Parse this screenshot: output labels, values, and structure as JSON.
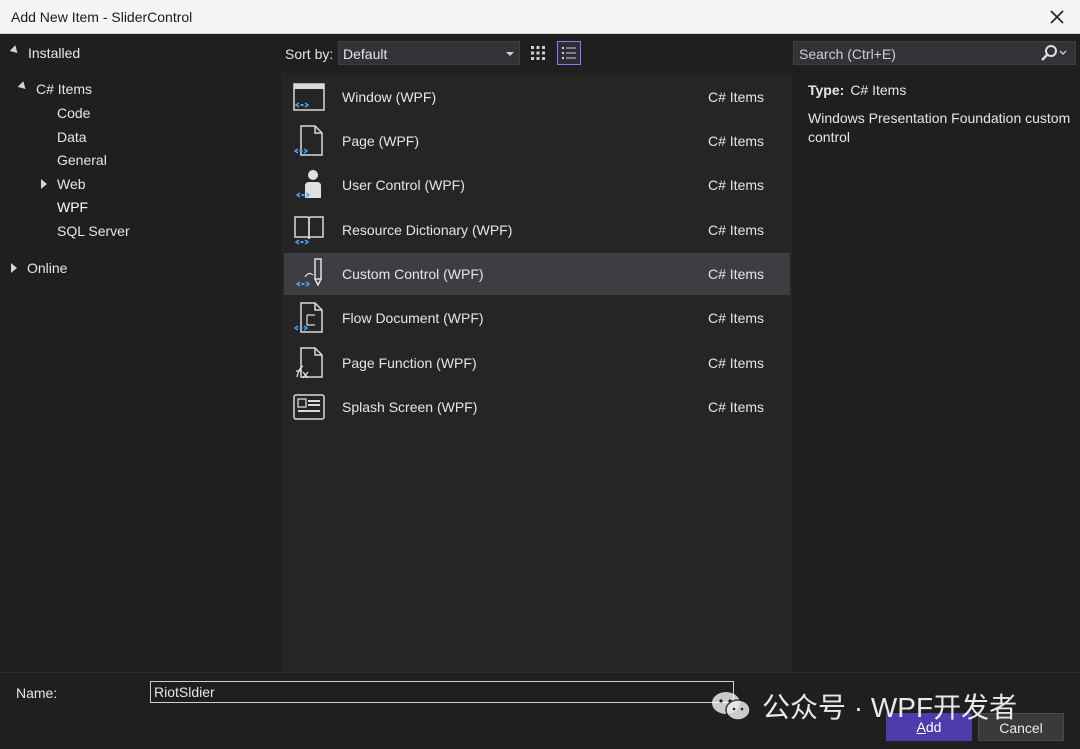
{
  "window": {
    "title": "Add New Item - SliderControl"
  },
  "tree": {
    "installed": "Installed",
    "csharp_items": "C# Items",
    "children": [
      "Code",
      "Data",
      "General",
      "Web",
      "WPF",
      "SQL Server"
    ],
    "online": "Online"
  },
  "toolbar": {
    "sort_label": "Sort by:",
    "sort_value": "Default"
  },
  "items": [
    {
      "name": "Window (WPF)",
      "category": "C# Items",
      "icon": "window-wpf-icon"
    },
    {
      "name": "Page (WPF)",
      "category": "C# Items",
      "icon": "page-wpf-icon"
    },
    {
      "name": "User Control (WPF)",
      "category": "C# Items",
      "icon": "user-control-icon"
    },
    {
      "name": "Resource Dictionary (WPF)",
      "category": "C# Items",
      "icon": "resource-dictionary-icon"
    },
    {
      "name": "Custom Control (WPF)",
      "category": "C# Items",
      "icon": "custom-control-icon",
      "selected": true
    },
    {
      "name": "Flow Document (WPF)",
      "category": "C# Items",
      "icon": "flow-document-icon"
    },
    {
      "name": "Page Function (WPF)",
      "category": "C# Items",
      "icon": "page-function-icon"
    },
    {
      "name": "Splash Screen (WPF)",
      "category": "C# Items",
      "icon": "splash-screen-icon"
    }
  ],
  "search": {
    "placeholder": "Search (Ctrl+E)"
  },
  "details": {
    "type_label": "Type:",
    "type_value": "C# Items",
    "description": "Windows Presentation Foundation custom control"
  },
  "footer": {
    "name_label": "Name:",
    "name_value": "RiotSldier",
    "add_accel": "A",
    "add_rest": "dd",
    "cancel": "Cancel"
  },
  "watermark": {
    "text": "公众号 · WPF开发者"
  },
  "colors": {
    "accent": "#4c3dab",
    "selection": "#3e3e42",
    "icon_blue": "#4fa3ff"
  }
}
